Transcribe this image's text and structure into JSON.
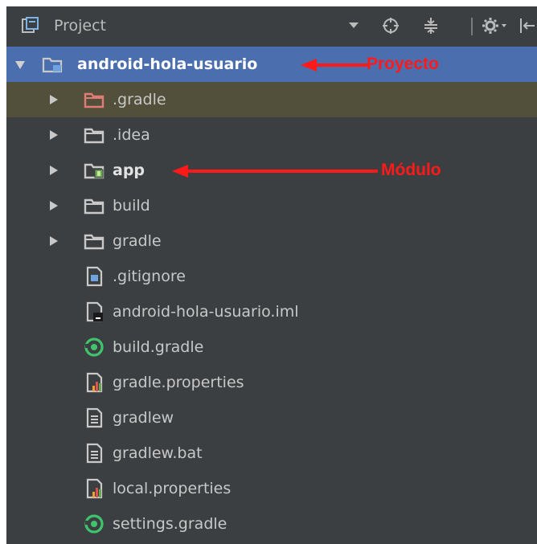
{
  "panel": {
    "title": "Project"
  },
  "tree": {
    "root": {
      "label": "android-hola-usuario"
    },
    "items": [
      {
        "label": ".gradle",
        "type": "folder-excluded"
      },
      {
        "label": ".idea",
        "type": "folder"
      },
      {
        "label": "app",
        "type": "module-folder"
      },
      {
        "label": "build",
        "type": "folder"
      },
      {
        "label": "gradle",
        "type": "folder"
      },
      {
        "label": ".gitignore",
        "type": "text-file"
      },
      {
        "label": "android-hola-usuario.iml",
        "type": "iml-file"
      },
      {
        "label": "build.gradle",
        "type": "gradle-file"
      },
      {
        "label": "gradle.properties",
        "type": "properties-file"
      },
      {
        "label": "gradlew",
        "type": "text-file"
      },
      {
        "label": "gradlew.bat",
        "type": "text-file"
      },
      {
        "label": "local.properties",
        "type": "properties-file"
      },
      {
        "label": "settings.gradle",
        "type": "gradle-file"
      }
    ]
  },
  "annotations": {
    "project": "Proyecto",
    "module": "Módulo"
  },
  "colors": {
    "panel_bg": "#3c3f41",
    "selection": "#4b6eaf",
    "highlight": "#52503a",
    "annotation": "#ff1a1a",
    "folder": "#c9c9c9",
    "excluded_folder": "#e07b78",
    "gradle_green": "#3ec46d"
  }
}
